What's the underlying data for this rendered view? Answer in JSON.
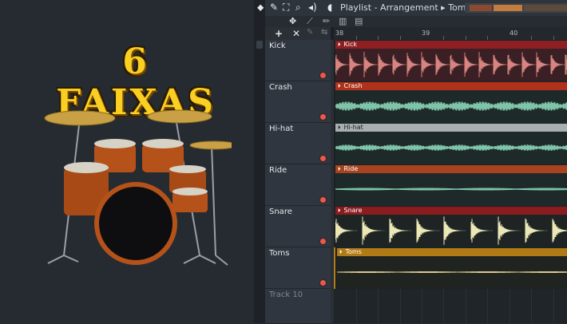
{
  "promo": {
    "title": "6 FAIXAS"
  },
  "playlist": {
    "title": "Playlist - Arrangement",
    "pattern": "Toms",
    "ruler": [
      "38",
      "39",
      "40"
    ],
    "tracks": [
      {
        "name": "Kick",
        "clip": "Kick",
        "clip_color": "#8e1f23",
        "wave_color": "#d8847f",
        "lane_bg": "#3a1f24"
      },
      {
        "name": "Crash",
        "clip": "Crash",
        "clip_color": "#b1321b",
        "wave_color": "#7fc3a8",
        "lane_bg": "#1e2a2a"
      },
      {
        "name": "Hi-hat",
        "clip": "Hi-hat",
        "clip_color": "#a9aeb3",
        "wave_color": "#7fc3a8",
        "lane_bg": "#1e2a2a"
      },
      {
        "name": "Ride",
        "clip": "Ride",
        "clip_color": "#a8421f",
        "wave_color": "#7fc3a8",
        "lane_bg": "#1e2a2a"
      },
      {
        "name": "Snare",
        "clip": "Snare",
        "clip_color": "#8a1c1f",
        "wave_color": "#ece8b6",
        "lane_bg": "#1e2424"
      },
      {
        "name": "Toms",
        "clip": "Toms",
        "clip_color": "#b07a14",
        "wave_color": "#e0c98a",
        "lane_bg": "#1f2420"
      }
    ],
    "empty_track": "Track 10"
  }
}
